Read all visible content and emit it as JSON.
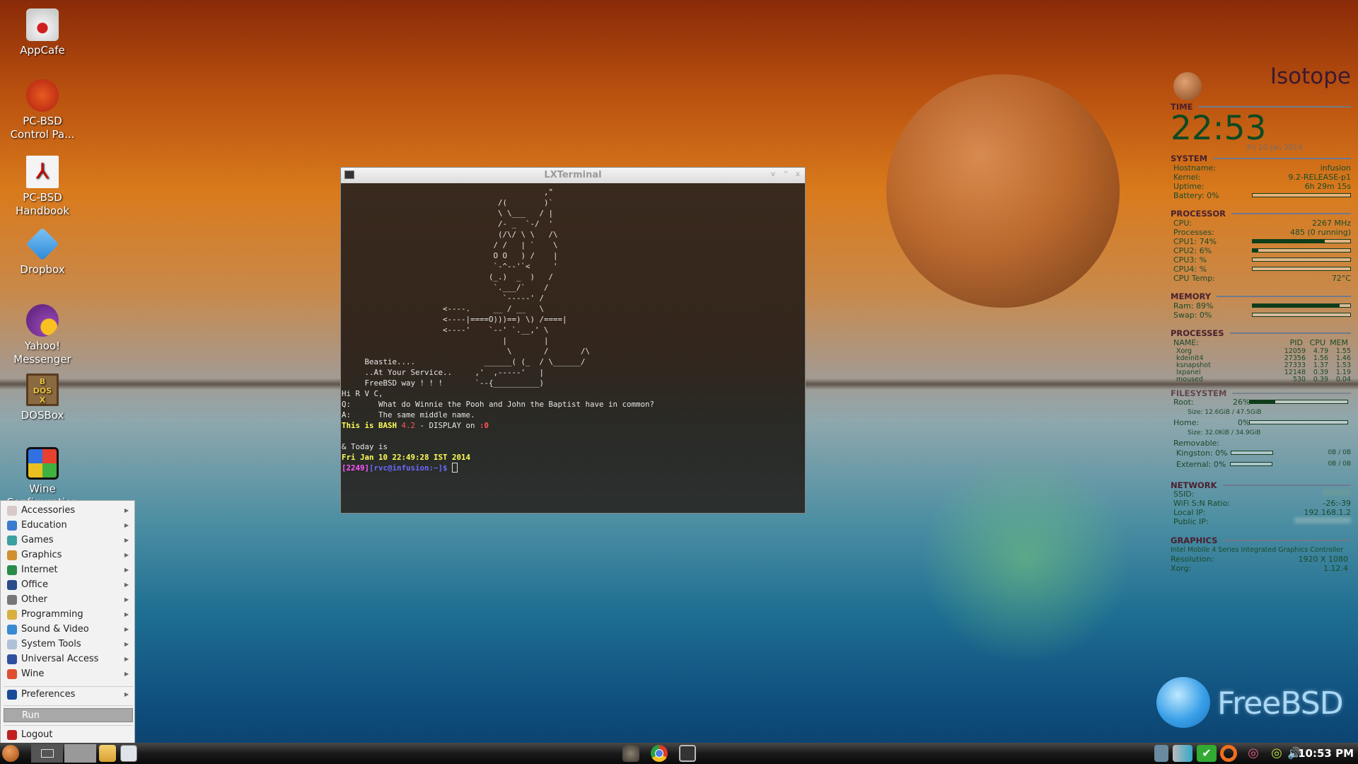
{
  "desktop_icons": [
    {
      "label": "AppCafe",
      "icon": "appcafe-mug-icon"
    },
    {
      "label": "PC-BSD Control Pa...",
      "icon": "control-panel-tools-icon"
    },
    {
      "label": "PC-BSD Handbook",
      "icon": "pdf-document-icon"
    },
    {
      "label": "Dropbox",
      "icon": "dropbox-icon"
    },
    {
      "label": "Yahoo! Messenger",
      "icon": "yahoo-messenger-icon"
    },
    {
      "label": "DOSBox",
      "icon": "dosbox-icon"
    },
    {
      "label": "Wine Configuration",
      "icon": "wine-config-icon"
    }
  ],
  "terminal": {
    "title": "LXTerminal",
    "buttons": [
      "v",
      "^",
      "x"
    ],
    "ascii": [
      "                                            ,\"",
      "                                  /(        )`",
      "                                  \\ \\___   / |",
      "                                  /- _  `-/  '",
      "                                  (/\\/ \\ \\   /\\",
      "                                 / /   | `    \\",
      "                                 O O   ) /    |",
      "                                 `-^--'`<     '",
      "                                (_.)  _  )   /",
      "                                 `.___/`    /",
      "                                   `-----' /",
      "                      <----.     __ / __   \\",
      "                      <----|====O)))==) \\) /====|",
      "                      <----'    `--' `.__,' \\",
      "                                   |        |",
      "                                    \\       /       /\\",
      "     Beastie....               ______( (_  / \\______/",
      "     ..At Your Service..     ,'  ,-----'   |",
      "     FreeBSD way ! ! !       `--{__________)"
    ],
    "greeting": "Hi R V C,",
    "q": "Q:      What do Winnie the Pooh and John the Baptist have in common?",
    "a": "A:      The same middle name.",
    "bash_pre": "This is BASH ",
    "bash_ver": "4.2",
    "bash_mid": " - DISPLAY on ",
    "bash_disp": ":0",
    "today": "& Today is",
    "date": "Fri Jan 10 22:49:28 IST 2014",
    "prompt_num": "[2249]",
    "prompt_user": "[rvc@infusion:~]$ "
  },
  "conky": {
    "theme": "Isotope",
    "time_label": "TIME",
    "time": "22:53",
    "date": "Fri 10 Jan 2014",
    "system": {
      "label": "SYSTEM",
      "hostname_l": "Hostname:",
      "hostname": "infusion",
      "kernel_l": "Kernel:",
      "kernel": "9.2-RELEASE-p1",
      "uptime_l": "Uptime:",
      "uptime": "6h 29m 15s",
      "battery": "Battery: 0%",
      "battery_pct": 0
    },
    "processor": {
      "label": "PROCESSOR",
      "cpu_l": "CPU:",
      "cpu": "2267 MHz",
      "proc_l": "Processes:",
      "proc": "485 (0 running)",
      "cpu1": "CPU1: 74%",
      "cpu1_pct": 74,
      "cpu2": "CPU2: 6%",
      "cpu2_pct": 6,
      "cpu3": "CPU3: %",
      "cpu3_pct": 0,
      "cpu4": "CPU4: %",
      "cpu4_pct": 0,
      "temp_l": "CPU Temp:",
      "temp": "72°C"
    },
    "memory": {
      "label": "MEMORY",
      "ram": "Ram: 89%",
      "ram_pct": 89,
      "swap": "Swap: 0%",
      "swap_pct": 0
    },
    "processes": {
      "label": "PROCESSES",
      "headers": [
        "NAME:",
        "PID",
        "CPU",
        "MEM"
      ],
      "rows": [
        [
          "Xorg",
          "12059",
          "4.79",
          "1.55"
        ],
        [
          "kdeinit4",
          "27356",
          "1.56",
          "1.46"
        ],
        [
          "ksnapshot",
          "27333",
          "1.37",
          "1.53"
        ],
        [
          "lxpanel",
          "12148",
          "0.39",
          "1.19"
        ],
        [
          "moused",
          "530",
          "0.39",
          "0.04"
        ]
      ]
    },
    "filesystem": {
      "label": "FILESYSTEM",
      "root_l": "Root:",
      "root": "26%",
      "root_pct": 26,
      "root_size": "Size: 12.6GiB / 47.5GiB",
      "home_l": "Home:",
      "home": "0%",
      "home_pct": 0,
      "home_size": "Size: 32.0KiB / 34.9GiB",
      "removable": "Removable:",
      "kingston": "Kingston: 0%",
      "kingston_size": "0B   / 0B",
      "external": "External: 0%",
      "external_size": "0B   / 0B"
    },
    "network": {
      "label": "NETWORK",
      "ssid_l": "SSID:",
      "wifi_l": "WiFi S:N Ratio:",
      "wifi": "-26:-39",
      "local_l": "Local IP:",
      "local": "192.168.1.2",
      "public_l": "Public IP:"
    },
    "graphics": {
      "label": "GRAPHICS",
      "card": "Intel Mobile 4 Series Integrated Graphics Controller",
      "res_l": "Resolution:",
      "res": "1920 X 1080",
      "xorg_l": "Xorg:",
      "xorg": "1.12.4"
    }
  },
  "menu": {
    "items": [
      {
        "label": "Accessories",
        "color": "#d8c8c8"
      },
      {
        "label": "Education",
        "color": "#3a7ad0"
      },
      {
        "label": "Games",
        "color": "#3aa0a0"
      },
      {
        "label": "Graphics",
        "color": "#d09030"
      },
      {
        "label": "Internet",
        "color": "#2a8a4a"
      },
      {
        "label": "Office",
        "color": "#2a4a8a"
      },
      {
        "label": "Other",
        "color": "#777777"
      },
      {
        "label": "Programming",
        "color": "#d8b040"
      },
      {
        "label": "Sound & Video",
        "color": "#3a8ad0"
      },
      {
        "label": "System Tools",
        "color": "#b0c0d8"
      },
      {
        "label": "Universal Access",
        "color": "#3050a0"
      },
      {
        "label": "Wine",
        "color": "#e05030"
      }
    ],
    "preferences": "Preferences",
    "run": "Run",
    "logout": "Logout"
  },
  "taskbar": {
    "clock": "10:53 PM"
  },
  "logo": "FreeBSD"
}
